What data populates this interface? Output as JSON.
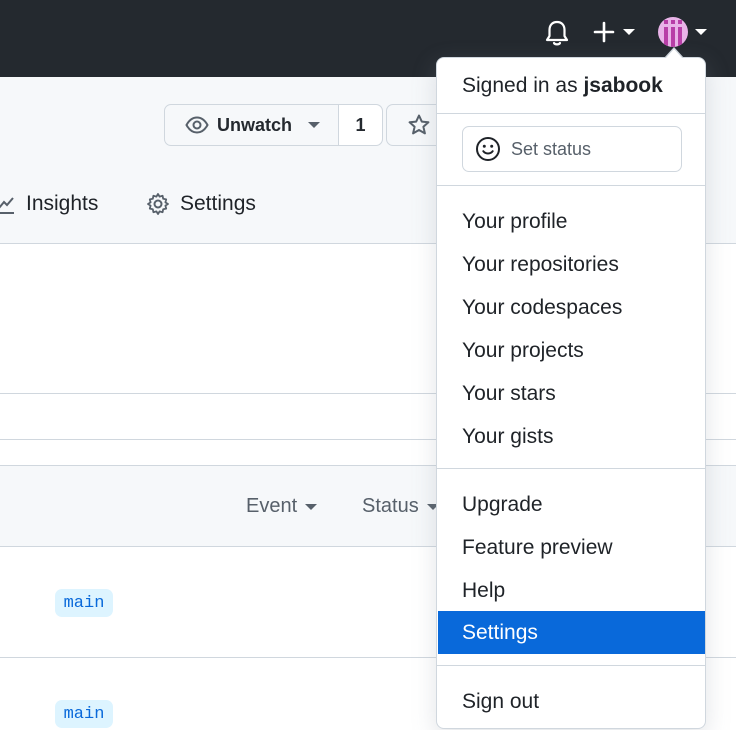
{
  "header": {
    "notification_icon": "bell-icon",
    "create_icon": "plus-icon",
    "avatar_colors": [
      "#e9b3e8",
      "#b83fa7"
    ]
  },
  "repo": {
    "watch_label": "Unwatch",
    "watch_count": "1",
    "star_icon": "star-icon",
    "tabs": [
      {
        "label": "Insights",
        "icon": "graph-icon"
      },
      {
        "label": "Settings",
        "icon": "gear-icon"
      }
    ]
  },
  "filters": [
    {
      "label": "Event"
    },
    {
      "label": "Status"
    }
  ],
  "rows": [
    {
      "branch": "main"
    },
    {
      "branch": "main"
    }
  ],
  "menu": {
    "signed_in_prefix": "Signed in as",
    "username": "jsabook",
    "set_status": "Set status",
    "group1": [
      "Your profile",
      "Your repositories",
      "Your codespaces",
      "Your projects",
      "Your stars",
      "Your gists"
    ],
    "group2": [
      "Upgrade",
      "Feature preview",
      "Help",
      "Settings"
    ],
    "sign_out": "Sign out",
    "active_item": "Settings",
    "active_color": "#0969da"
  }
}
